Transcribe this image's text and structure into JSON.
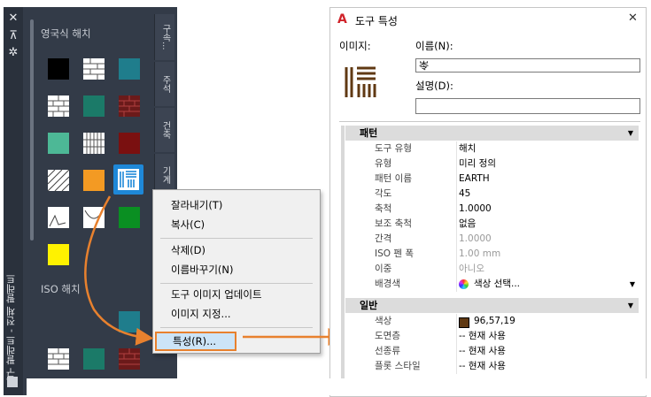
{
  "palette": {
    "title": "도구 팔레트 - 전체 팔레트",
    "titlebar_icons": [
      "close-icon",
      "pin-icon",
      "properties-gear-icon"
    ],
    "section1_title": "영국식 해치",
    "section2_title": "ISO 해치",
    "tabs": [
      "구속...",
      "주석",
      "건축",
      "기계"
    ],
    "colors": {
      "black": "#000000",
      "teal": "#1f7d8c",
      "green": "#1b7a68",
      "mint": "#4db896",
      "darkred": "#7a1010",
      "orange": "#f39a23",
      "brightgreen": "#0a8f22",
      "yellow": "#fff200",
      "selected": "#1e88d8"
    }
  },
  "context_menu": {
    "items": [
      "잘라내기(T)",
      "복사(C)",
      "삭제(D)",
      "이름바꾸기(N)",
      "도구 이미지 업데이트",
      "이미지 지정...",
      "특성(R)..."
    ],
    "highlighted": "특성(R)..."
  },
  "dialog": {
    "title": "도구 특성",
    "close_glyph": "✕",
    "image_label": "이미지:",
    "name_label": "이름(N):",
    "name_value": "岺",
    "desc_label": "설명(D):",
    "desc_value": "",
    "pattern_section": "패턴",
    "general_section": "일반",
    "pattern_rows": [
      {
        "key": "도구 유형",
        "value": "해치"
      },
      {
        "key": "유형",
        "value": "미리 정의"
      },
      {
        "key": "패턴 이름",
        "value": "EARTH"
      },
      {
        "key": "각도",
        "value": "45"
      },
      {
        "key": "축척",
        "value": "1.0000"
      },
      {
        "key": "보조 축척",
        "value": "없음"
      },
      {
        "key": "간격",
        "value": "1.0000"
      },
      {
        "key": "ISO 펜 폭",
        "value": "1.00 mm"
      },
      {
        "key": "이중",
        "value": "아니오"
      },
      {
        "key": "배경색",
        "value": "색상 선택..."
      }
    ],
    "general_rows": [
      {
        "key": "색상",
        "value": "96,57,19"
      },
      {
        "key": "도면층",
        "value": "-- 현재 사용"
      },
      {
        "key": "선종류",
        "value": "-- 현재 사용"
      },
      {
        "key": "플롯 스타일",
        "value": "-- 현재 사용"
      }
    ],
    "swatch_color": "#603913",
    "accent": "#e8812e"
  }
}
